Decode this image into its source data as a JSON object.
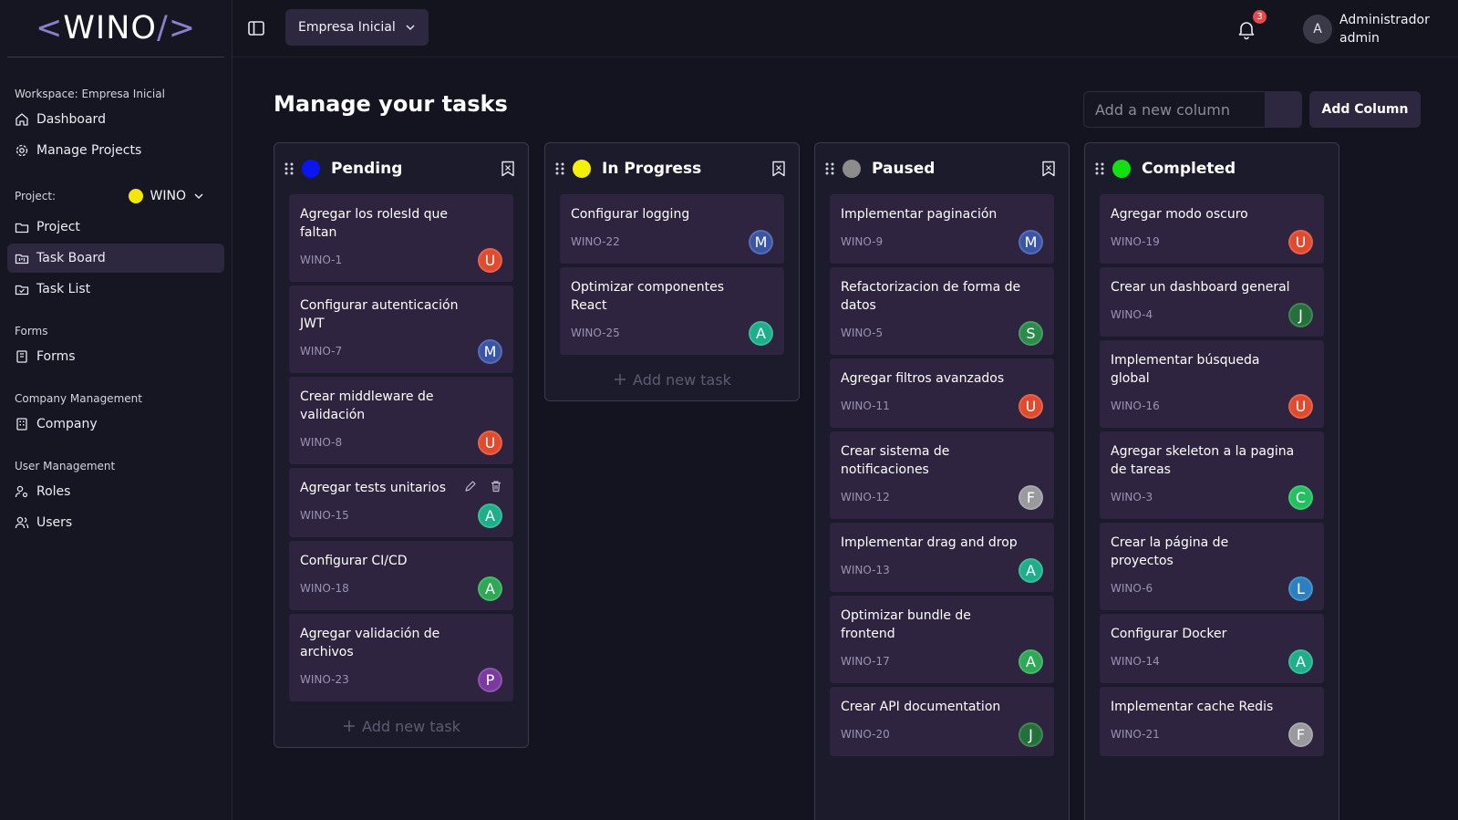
{
  "sidebar": {
    "logo": {
      "open": "<",
      "text": "WINO",
      "close": "/>"
    },
    "workspace_label": "Workspace: Empresa Inicial",
    "workspace_items": [
      {
        "label": "Dashboard",
        "icon": "home-icon"
      },
      {
        "label": "Manage Projects",
        "icon": "gear-icon"
      }
    ],
    "project_label": "Project:",
    "project_select": {
      "value": "WINO",
      "color": "#f5e60a"
    },
    "project_items": [
      {
        "label": "Project",
        "icon": "folder-icon"
      },
      {
        "label": "Task Board",
        "icon": "folder-kanban-icon",
        "active": true
      },
      {
        "label": "Task List",
        "icon": "folder-check-icon"
      }
    ],
    "forms_label": "Forms",
    "forms_items": [
      {
        "label": "Forms",
        "icon": "notebook-icon"
      }
    ],
    "company_label": "Company Management",
    "company_items": [
      {
        "label": "Company",
        "icon": "building-icon"
      }
    ],
    "user_label": "User Management",
    "user_items": [
      {
        "label": "Roles",
        "icon": "user-cog-icon"
      },
      {
        "label": "Users",
        "icon": "users-icon"
      }
    ]
  },
  "topbar": {
    "company_select": "Empresa Inicial",
    "notification_count": "3",
    "user_initial": "A",
    "user_name": "Administrador",
    "user_role": "admin"
  },
  "main": {
    "title": "Manage your tasks",
    "new_column_placeholder": "Add a new column",
    "add_column_label": "Add Column",
    "add_task_label": "Add new task"
  },
  "columns": [
    {
      "title": "Pending",
      "color": "#0a16f0",
      "show_add": true,
      "cards": [
        {
          "title": "Agregar los rolesId que faltan",
          "code": "WINO-1",
          "initial": "U",
          "color": "#e04a2e"
        },
        {
          "title": "Configurar autenticación JWT",
          "code": "WINO-7",
          "initial": "M",
          "color": "#3b55a6"
        },
        {
          "title": "Crear middleware de validación",
          "code": "WINO-8",
          "initial": "U",
          "color": "#e04a2e"
        },
        {
          "title": "Agregar tests unitarios",
          "code": "WINO-15",
          "initial": "A",
          "color": "#1fae8a",
          "hover": true
        },
        {
          "title": "Configurar CI/CD",
          "code": "WINO-18",
          "initial": "A",
          "color": "#2ea855"
        },
        {
          "title": "Agregar validación de archivos",
          "code": "WINO-23",
          "initial": "P",
          "color": "#7a3aa0"
        }
      ]
    },
    {
      "title": "In Progress",
      "color": "#f5f00a",
      "show_add": true,
      "cards": [
        {
          "title": "Configurar logging",
          "code": "WINO-22",
          "initial": "M",
          "color": "#3b55a6"
        },
        {
          "title": "Optimizar componentes React",
          "code": "WINO-25",
          "initial": "A",
          "color": "#1fae8a"
        }
      ]
    },
    {
      "title": "Paused",
      "color": "#8c8c8c",
      "show_add": false,
      "cards": [
        {
          "title": "Implementar paginación",
          "code": "WINO-9",
          "initial": "M",
          "color": "#3b55a6"
        },
        {
          "title": "Refactorizacion de forma de datos",
          "code": "WINO-5",
          "initial": "S",
          "color": "#2c8a4a"
        },
        {
          "title": "Agregar filtros avanzados",
          "code": "WINO-11",
          "initial": "U",
          "color": "#e04a2e"
        },
        {
          "title": "Crear sistema de notificaciones",
          "code": "WINO-12",
          "initial": "F",
          "color": "#9a9a9e"
        },
        {
          "title": "Implementar drag and drop",
          "code": "WINO-13",
          "initial": "A",
          "color": "#1fae8a"
        },
        {
          "title": "Optimizar bundle de frontend",
          "code": "WINO-17",
          "initial": "A",
          "color": "#2ea855"
        },
        {
          "title": "Crear API documentation",
          "code": "WINO-20",
          "initial": "J",
          "color": "#24703a"
        }
      ]
    },
    {
      "title": "Completed",
      "color": "#12e012",
      "show_add": false,
      "cards": [
        {
          "title": "Agregar modo oscuro",
          "code": "WINO-19",
          "initial": "U",
          "color": "#e04a2e"
        },
        {
          "title": "Crear un dashboard general",
          "code": "WINO-4",
          "initial": "J",
          "color": "#24703a"
        },
        {
          "title": "Implementar búsqueda global",
          "code": "WINO-16",
          "initial": "U",
          "color": "#e04a2e"
        },
        {
          "title": "Agregar skeleton a la pagina de tareas",
          "code": "WINO-3",
          "initial": "C",
          "color": "#22c060"
        },
        {
          "title": "Crear la página de proyectos",
          "code": "WINO-6",
          "initial": "L",
          "color": "#2a80c0"
        },
        {
          "title": "Configurar Docker",
          "code": "WINO-14",
          "initial": "A",
          "color": "#1fae8a"
        },
        {
          "title": "Implementar cache Redis",
          "code": "WINO-21",
          "initial": "F",
          "color": "#9a9a9e"
        }
      ]
    }
  ]
}
